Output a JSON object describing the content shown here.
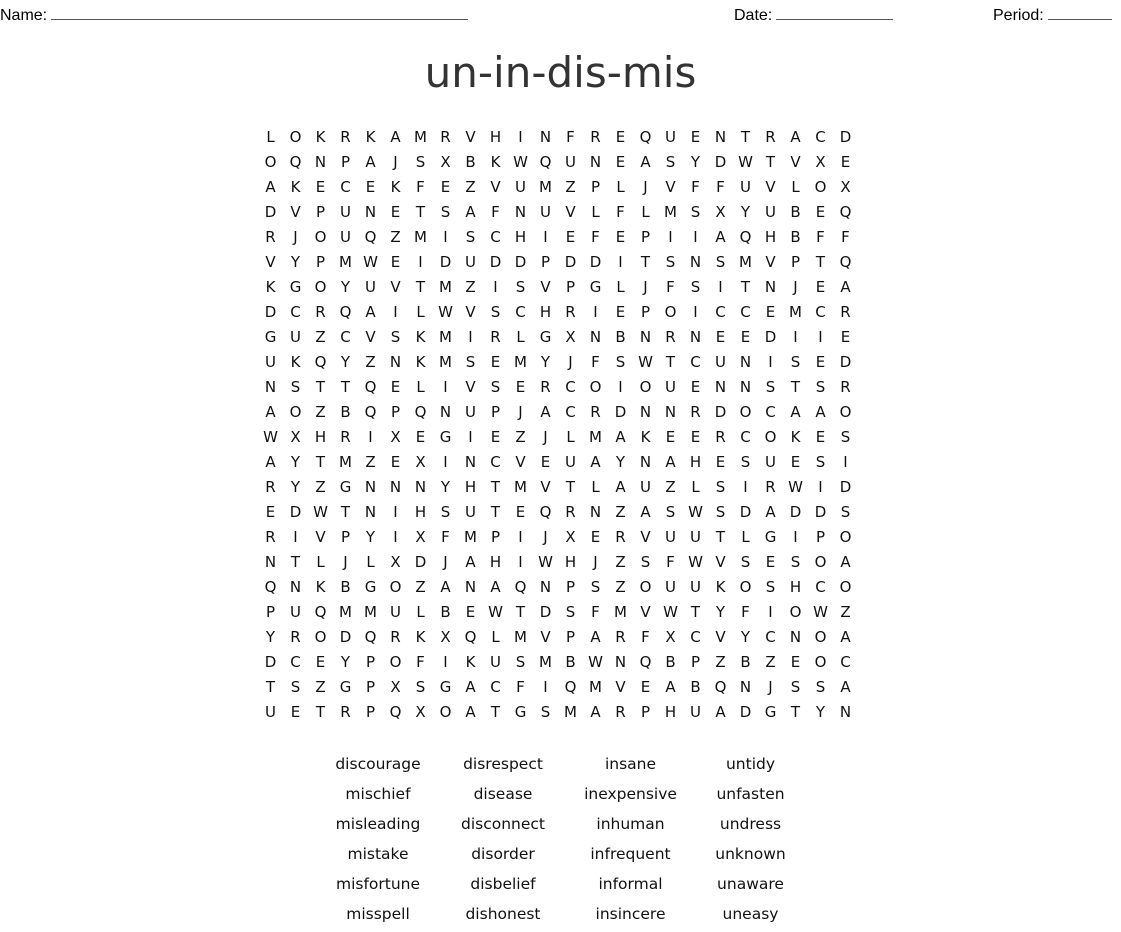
{
  "header": {
    "name_label": "Name:",
    "date_label": "Date:",
    "period_label": "Period:"
  },
  "title": "un-in-dis-mis",
  "grid": [
    [
      "L",
      "O",
      "K",
      "R",
      "K",
      "A",
      "M",
      "R",
      "V",
      "H",
      "I",
      "N",
      "F",
      "R",
      "E",
      "Q",
      "U",
      "E",
      "N",
      "T",
      "R",
      "A",
      "C",
      "D"
    ],
    [
      "O",
      "Q",
      "N",
      "P",
      "A",
      "J",
      "S",
      "X",
      "B",
      "K",
      "W",
      "Q",
      "U",
      "N",
      "E",
      "A",
      "S",
      "Y",
      "D",
      "W",
      "T",
      "V",
      "X",
      "E"
    ],
    [
      "A",
      "K",
      "E",
      "C",
      "E",
      "K",
      "F",
      "E",
      "Z",
      "V",
      "U",
      "M",
      "Z",
      "P",
      "L",
      "J",
      "V",
      "F",
      "F",
      "U",
      "V",
      "L",
      "O",
      "X"
    ],
    [
      "D",
      "V",
      "P",
      "U",
      "N",
      "E",
      "T",
      "S",
      "A",
      "F",
      "N",
      "U",
      "V",
      "L",
      "F",
      "L",
      "M",
      "S",
      "X",
      "Y",
      "U",
      "B",
      "E",
      "Q"
    ],
    [
      "R",
      "J",
      "O",
      "U",
      "Q",
      "Z",
      "M",
      "I",
      "S",
      "C",
      "H",
      "I",
      "E",
      "F",
      "E",
      "P",
      "I",
      "I",
      "A",
      "Q",
      "H",
      "B",
      "F",
      "F"
    ],
    [
      "V",
      "Y",
      "P",
      "M",
      "W",
      "E",
      "I",
      "D",
      "U",
      "D",
      "D",
      "P",
      "D",
      "D",
      "I",
      "T",
      "S",
      "N",
      "S",
      "M",
      "V",
      "P",
      "T",
      "Q"
    ],
    [
      "K",
      "G",
      "O",
      "Y",
      "U",
      "V",
      "T",
      "M",
      "Z",
      "I",
      "S",
      "V",
      "P",
      "G",
      "L",
      "J",
      "F",
      "S",
      "I",
      "T",
      "N",
      "J",
      "E",
      "A"
    ],
    [
      "D",
      "C",
      "R",
      "Q",
      "A",
      "I",
      "L",
      "W",
      "V",
      "S",
      "C",
      "H",
      "R",
      "I",
      "E",
      "P",
      "O",
      "I",
      "C",
      "C",
      "E",
      "M",
      "C",
      "R"
    ],
    [
      "G",
      "U",
      "Z",
      "C",
      "V",
      "S",
      "K",
      "M",
      "I",
      "R",
      "L",
      "G",
      "X",
      "N",
      "B",
      "N",
      "R",
      "N",
      "E",
      "E",
      "D",
      "I",
      "I",
      "E"
    ],
    [
      "U",
      "K",
      "Q",
      "Y",
      "Z",
      "N",
      "K",
      "M",
      "S",
      "E",
      "M",
      "Y",
      "J",
      "F",
      "S",
      "W",
      "T",
      "C",
      "U",
      "N",
      "I",
      "S",
      "E",
      "D"
    ],
    [
      "N",
      "S",
      "T",
      "T",
      "Q",
      "E",
      "L",
      "I",
      "V",
      "S",
      "E",
      "R",
      "C",
      "O",
      "I",
      "O",
      "U",
      "E",
      "N",
      "N",
      "S",
      "T",
      "S",
      "R"
    ],
    [
      "A",
      "O",
      "Z",
      "B",
      "Q",
      "P",
      "Q",
      "N",
      "U",
      "P",
      "J",
      "A",
      "C",
      "R",
      "D",
      "N",
      "N",
      "R",
      "D",
      "O",
      "C",
      "A",
      "A",
      "O"
    ],
    [
      "W",
      "X",
      "H",
      "R",
      "I",
      "X",
      "E",
      "G",
      "I",
      "E",
      "Z",
      "J",
      "L",
      "M",
      "A",
      "K",
      "E",
      "E",
      "R",
      "C",
      "O",
      "K",
      "E",
      "S"
    ],
    [
      "A",
      "Y",
      "T",
      "M",
      "Z",
      "E",
      "X",
      "I",
      "N",
      "C",
      "V",
      "E",
      "U",
      "A",
      "Y",
      "N",
      "A",
      "H",
      "E",
      "S",
      "U",
      "E",
      "S",
      "I"
    ],
    [
      "R",
      "Y",
      "Z",
      "G",
      "N",
      "N",
      "N",
      "Y",
      "H",
      "T",
      "M",
      "V",
      "T",
      "L",
      "A",
      "U",
      "Z",
      "L",
      "S",
      "I",
      "R",
      "W",
      "I",
      "D"
    ],
    [
      "E",
      "D",
      "W",
      "T",
      "N",
      "I",
      "H",
      "S",
      "U",
      "T",
      "E",
      "Q",
      "R",
      "N",
      "Z",
      "A",
      "S",
      "W",
      "S",
      "D",
      "A",
      "D",
      "D",
      "S"
    ],
    [
      "R",
      "I",
      "V",
      "P",
      "Y",
      "I",
      "X",
      "F",
      "M",
      "P",
      "I",
      "J",
      "X",
      "E",
      "R",
      "V",
      "U",
      "U",
      "T",
      "L",
      "G",
      "I",
      "P",
      "O"
    ],
    [
      "N",
      "T",
      "L",
      "J",
      "L",
      "X",
      "D",
      "J",
      "A",
      "H",
      "I",
      "W",
      "H",
      "J",
      "Z",
      "S",
      "F",
      "W",
      "V",
      "S",
      "E",
      "S",
      "O",
      "A"
    ],
    [
      "Q",
      "N",
      "K",
      "B",
      "G",
      "O",
      "Z",
      "A",
      "N",
      "A",
      "Q",
      "N",
      "P",
      "S",
      "Z",
      "O",
      "U",
      "U",
      "K",
      "O",
      "S",
      "H",
      "C",
      "O"
    ],
    [
      "P",
      "U",
      "Q",
      "M",
      "M",
      "U",
      "L",
      "B",
      "E",
      "W",
      "T",
      "D",
      "S",
      "F",
      "M",
      "V",
      "W",
      "T",
      "Y",
      "F",
      "I",
      "O",
      "W",
      "Z"
    ],
    [
      "Y",
      "R",
      "O",
      "D",
      "Q",
      "R",
      "K",
      "X",
      "Q",
      "L",
      "M",
      "V",
      "P",
      "A",
      "R",
      "F",
      "X",
      "C",
      "V",
      "Y",
      "C",
      "N",
      "O",
      "A"
    ],
    [
      "D",
      "C",
      "E",
      "Y",
      "P",
      "O",
      "F",
      "I",
      "K",
      "U",
      "S",
      "M",
      "B",
      "W",
      "N",
      "Q",
      "B",
      "P",
      "Z",
      "B",
      "Z",
      "E",
      "O",
      "C"
    ],
    [
      "T",
      "S",
      "Z",
      "G",
      "P",
      "X",
      "S",
      "G",
      "A",
      "C",
      "F",
      "I",
      "Q",
      "M",
      "V",
      "E",
      "A",
      "B",
      "Q",
      "N",
      "J",
      "S",
      "S",
      "A"
    ],
    [
      "U",
      "E",
      "T",
      "R",
      "P",
      "Q",
      "X",
      "O",
      "A",
      "T",
      "G",
      "S",
      "M",
      "A",
      "R",
      "P",
      "H",
      "U",
      "A",
      "D",
      "G",
      "T",
      "Y",
      "N"
    ]
  ],
  "word_bank": [
    [
      "discourage",
      "disrespect",
      "insane",
      "untidy"
    ],
    [
      "mischief",
      "disease",
      "inexpensive",
      "unfasten"
    ],
    [
      "misleading",
      "disconnect",
      "inhuman",
      "undress"
    ],
    [
      "mistake",
      "disorder",
      "infrequent",
      "unknown"
    ],
    [
      "misfortune",
      "disbelief",
      "informal",
      "unaware"
    ],
    [
      "misspell",
      "dishonest",
      "insincere",
      "uneasy"
    ]
  ]
}
